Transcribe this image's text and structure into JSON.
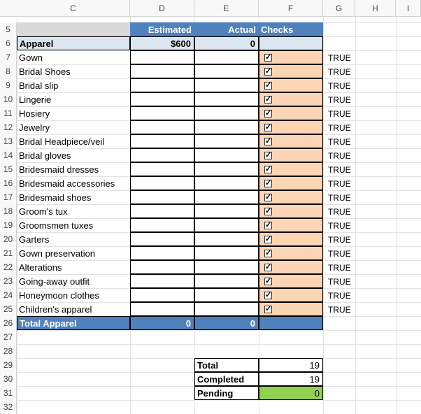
{
  "columns": [
    "C",
    "D",
    "E",
    "F",
    "G",
    "H",
    "I"
  ],
  "header": {
    "estimated": "Estimated",
    "actual": "Actual",
    "checks": "Checks"
  },
  "section": {
    "label": "Apparel",
    "estimated": "$600",
    "actual": "0"
  },
  "row_numbers": [
    "5",
    "6",
    "7",
    "8",
    "9",
    "10",
    "11",
    "12",
    "13",
    "14",
    "15",
    "16",
    "17",
    "18",
    "19",
    "20",
    "21",
    "22",
    "23",
    "24",
    "25",
    "26",
    "27",
    "28",
    "29",
    "30",
    "31",
    "32"
  ],
  "items": [
    "Gown",
    "Bridal Shoes",
    "Bridal slip",
    "Lingerie",
    "Hosiery",
    "Jewelry",
    "Bridal Headpiece/veil",
    "Bridal gloves",
    "Bridesmaid dresses",
    "Bridesmaid accessories",
    "Bridesmaid shoes",
    "Groom's tux",
    "Groomsmen tuxes",
    "Garters",
    "Gown preservation",
    "Alterations",
    "Going-away outfit",
    "Honeymoon clothes",
    "Children's apparel"
  ],
  "true_label": "TRUE",
  "check_mark": "✓",
  "total": {
    "label": "Total Apparel",
    "estimated": "0",
    "actual": "0"
  },
  "summary": [
    {
      "label": "Total",
      "value": "19"
    },
    {
      "label": "Completed",
      "value": "19"
    },
    {
      "label": "Pending",
      "value": "0"
    }
  ],
  "colors": {
    "blue": "#4f81bd",
    "light_blue": "#dce6f1",
    "peach": "#fcd5b4",
    "green": "#92d050"
  }
}
